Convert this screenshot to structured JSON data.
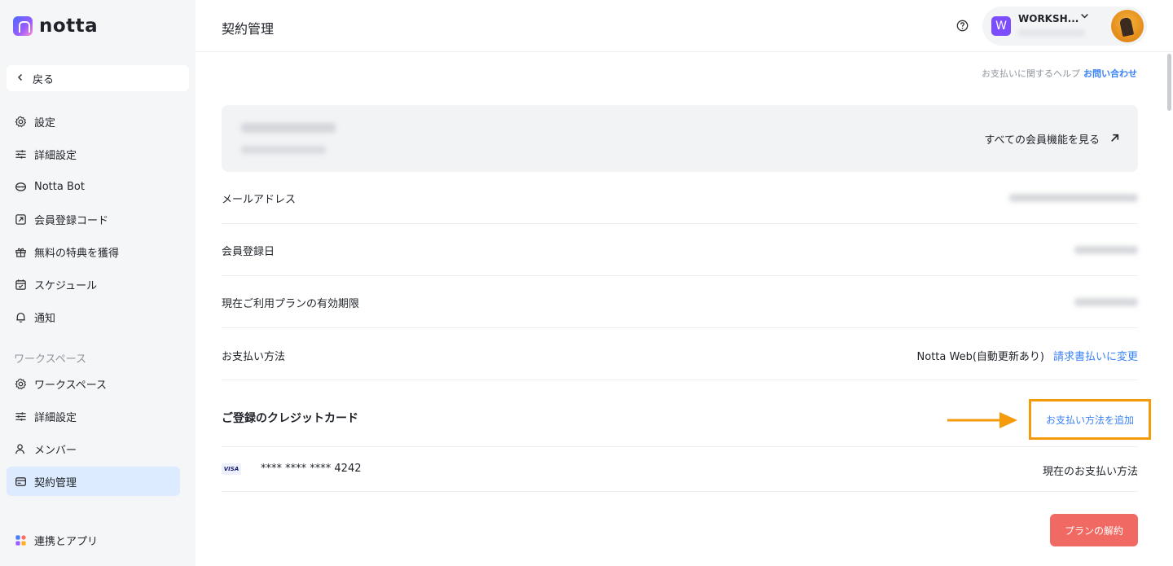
{
  "app": {
    "logo_text": "notta"
  },
  "sidebar": {
    "back_label": "戻る",
    "items": [
      {
        "label": "設定",
        "icon": "gear-icon"
      },
      {
        "label": "詳細設定",
        "icon": "sliders-icon"
      },
      {
        "label": "Notta Bot",
        "icon": "bot-icon"
      },
      {
        "label": "会員登録コード",
        "icon": "code-icon"
      },
      {
        "label": "無料の特典を獲得",
        "icon": "gift-icon"
      },
      {
        "label": "スケジュール",
        "icon": "calendar-icon"
      },
      {
        "label": "通知",
        "icon": "bell-icon"
      }
    ],
    "workspace_section_label": "ワークスペース",
    "workspace_items": [
      {
        "label": "ワークスペース",
        "icon": "gear-icon"
      },
      {
        "label": "詳細設定",
        "icon": "sliders-icon"
      },
      {
        "label": "メンバー",
        "icon": "user-icon"
      },
      {
        "label": "契約管理",
        "icon": "card-icon",
        "active": true
      }
    ],
    "integrations_label": "連携とアプリ"
  },
  "header": {
    "title": "契約管理",
    "workspace": {
      "initial": "W",
      "name": "WORKSH..."
    }
  },
  "main": {
    "help_text": "お支払いに関するヘルプ",
    "help_link": "お問い合わせ",
    "plan_card": {
      "link_label": "すべての会員機能を見る"
    },
    "rows": {
      "email_label": "メールアドレス",
      "registered_label": "会員登録日",
      "expiry_label": "現在ご利用プランの有効期限",
      "payment_label": "お支払い方法",
      "payment_value": "Notta Web(自動更新あり)",
      "payment_change_link": "請求書払いに変更"
    },
    "cards": {
      "title": "ご登録のクレジットカード",
      "add_link": "お支払い方法を追加",
      "brand": "VISA",
      "number": "**** **** **** 4242",
      "status": "現在のお支払い方法"
    },
    "cancel_button": "プランの解約"
  },
  "colors": {
    "accent": "#3a82f7",
    "active_nav": "#dcebff",
    "annotation": "#f59a0b",
    "danger": "#f06a63"
  }
}
